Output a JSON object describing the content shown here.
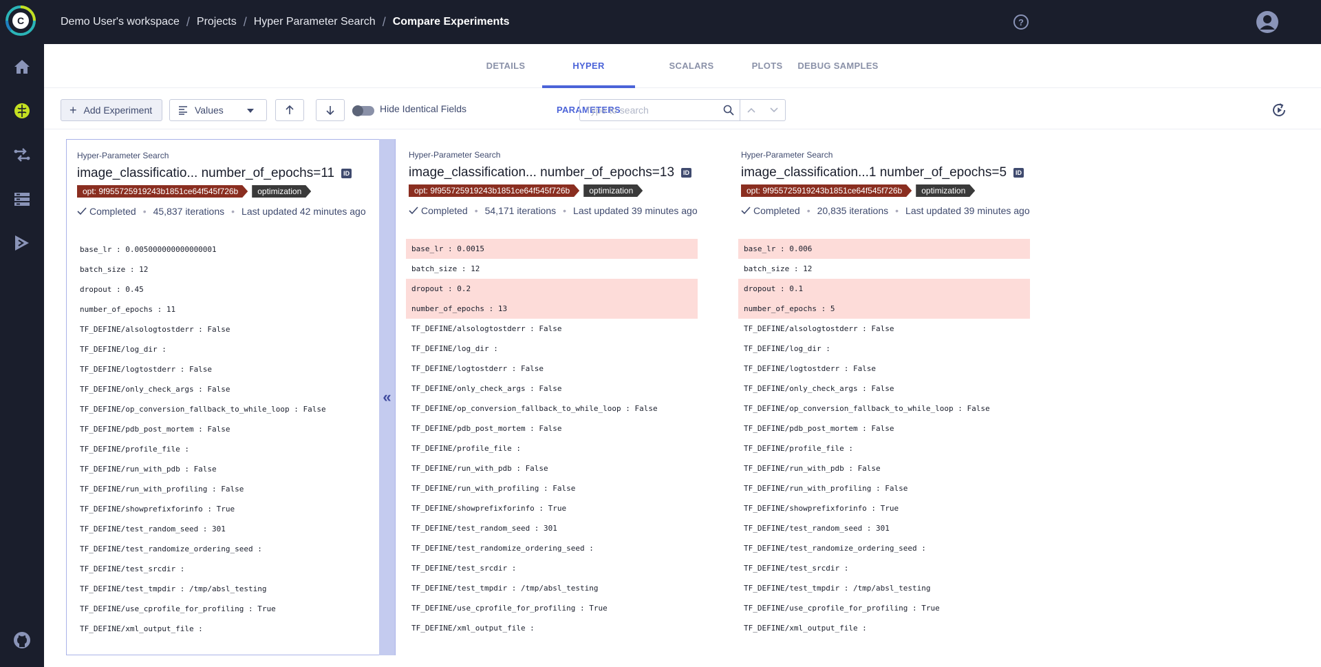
{
  "breadcrumb": {
    "workspace": "Demo User's workspace",
    "projects": "Projects",
    "project": "Hyper Parameter Search",
    "current": "Compare Experiments"
  },
  "tabs": [
    "DETAILS",
    "HYPER PARAMETERS",
    "SCALARS",
    "PLOTS",
    "DEBUG SAMPLES"
  ],
  "active_tab": "HYPER PARAMETERS",
  "toolbar": {
    "add_experiment": "Add Experiment",
    "values_select": "Values",
    "hide_identical": "Hide Identical Fields",
    "search_placeholder": "Type to search"
  },
  "colors": {
    "accent": "#4b63d8",
    "diff_row": "#fddcd9",
    "sidebar": "#1a1e2c",
    "brain_icon": "#c4e021"
  },
  "experiments": [
    {
      "type": "Hyper-Parameter Search",
      "name": "image_classificatio... number_of_epochs=11",
      "id_badge": "ID",
      "tag_opt": "opt: 9f955725919243b1851ce64f545f726b",
      "tag_optim": "optimization",
      "status": "Completed",
      "iterations": "45,837 iterations",
      "updated": "Last updated 42 minutes ago",
      "params": [
        {
          "text": "base_lr : 0.005000000000000001",
          "diff": false
        },
        {
          "text": "batch_size : 12",
          "diff": false
        },
        {
          "text": "dropout : 0.45",
          "diff": false
        },
        {
          "text": "number_of_epochs : 11",
          "diff": false
        },
        {
          "text": "TF_DEFINE/alsologtostderr : False",
          "diff": false
        },
        {
          "text": "TF_DEFINE/log_dir :",
          "diff": false
        },
        {
          "text": "TF_DEFINE/logtostderr : False",
          "diff": false
        },
        {
          "text": "TF_DEFINE/only_check_args : False",
          "diff": false
        },
        {
          "text": "TF_DEFINE/op_conversion_fallback_to_while_loop : False",
          "diff": false
        },
        {
          "text": "TF_DEFINE/pdb_post_mortem : False",
          "diff": false
        },
        {
          "text": "TF_DEFINE/profile_file :",
          "diff": false
        },
        {
          "text": "TF_DEFINE/run_with_pdb : False",
          "diff": false
        },
        {
          "text": "TF_DEFINE/run_with_profiling : False",
          "diff": false
        },
        {
          "text": "TF_DEFINE/showprefixforinfo : True",
          "diff": false
        },
        {
          "text": "TF_DEFINE/test_random_seed : 301",
          "diff": false
        },
        {
          "text": "TF_DEFINE/test_randomize_ordering_seed :",
          "diff": false
        },
        {
          "text": "TF_DEFINE/test_srcdir :",
          "diff": false
        },
        {
          "text": "TF_DEFINE/test_tmpdir : /tmp/absl_testing",
          "diff": false
        },
        {
          "text": "TF_DEFINE/use_cprofile_for_profiling : True",
          "diff": false
        },
        {
          "text": "TF_DEFINE/xml_output_file :",
          "diff": false
        }
      ]
    },
    {
      "type": "Hyper-Parameter Search",
      "name": "image_classification... number_of_epochs=13",
      "id_badge": "ID",
      "tag_opt": "opt: 9f955725919243b1851ce64f545f726b",
      "tag_optim": "optimization",
      "status": "Completed",
      "iterations": "54,171 iterations",
      "updated": "Last updated 39 minutes ago",
      "params": [
        {
          "text": "base_lr : 0.0015",
          "diff": true
        },
        {
          "text": "batch_size : 12",
          "diff": false
        },
        {
          "text": "dropout : 0.2",
          "diff": true
        },
        {
          "text": "number_of_epochs : 13",
          "diff": true
        },
        {
          "text": "TF_DEFINE/alsologtostderr : False",
          "diff": false
        },
        {
          "text": "TF_DEFINE/log_dir :",
          "diff": false
        },
        {
          "text": "TF_DEFINE/logtostderr : False",
          "diff": false
        },
        {
          "text": "TF_DEFINE/only_check_args : False",
          "diff": false
        },
        {
          "text": "TF_DEFINE/op_conversion_fallback_to_while_loop : False",
          "diff": false
        },
        {
          "text": "TF_DEFINE/pdb_post_mortem : False",
          "diff": false
        },
        {
          "text": "TF_DEFINE/profile_file :",
          "diff": false
        },
        {
          "text": "TF_DEFINE/run_with_pdb : False",
          "diff": false
        },
        {
          "text": "TF_DEFINE/run_with_profiling : False",
          "diff": false
        },
        {
          "text": "TF_DEFINE/showprefixforinfo : True",
          "diff": false
        },
        {
          "text": "TF_DEFINE/test_random_seed : 301",
          "diff": false
        },
        {
          "text": "TF_DEFINE/test_randomize_ordering_seed :",
          "diff": false
        },
        {
          "text": "TF_DEFINE/test_srcdir :",
          "diff": false
        },
        {
          "text": "TF_DEFINE/test_tmpdir : /tmp/absl_testing",
          "diff": false
        },
        {
          "text": "TF_DEFINE/use_cprofile_for_profiling : True",
          "diff": false
        },
        {
          "text": "TF_DEFINE/xml_output_file :",
          "diff": false
        }
      ]
    },
    {
      "type": "Hyper-Parameter Search",
      "name": "image_classification...1 number_of_epochs=5",
      "id_badge": "ID",
      "tag_opt": "opt: 9f955725919243b1851ce64f545f726b",
      "tag_optim": "optimization",
      "status": "Completed",
      "iterations": "20,835 iterations",
      "updated": "Last updated 39 minutes ago",
      "params": [
        {
          "text": "base_lr : 0.006",
          "diff": true
        },
        {
          "text": "batch_size : 12",
          "diff": false
        },
        {
          "text": "dropout : 0.1",
          "diff": true
        },
        {
          "text": "number_of_epochs : 5",
          "diff": true
        },
        {
          "text": "TF_DEFINE/alsologtostderr : False",
          "diff": false
        },
        {
          "text": "TF_DEFINE/log_dir :",
          "diff": false
        },
        {
          "text": "TF_DEFINE/logtostderr : False",
          "diff": false
        },
        {
          "text": "TF_DEFINE/only_check_args : False",
          "diff": false
        },
        {
          "text": "TF_DEFINE/op_conversion_fallback_to_while_loop : False",
          "diff": false
        },
        {
          "text": "TF_DEFINE/pdb_post_mortem : False",
          "diff": false
        },
        {
          "text": "TF_DEFINE/profile_file :",
          "diff": false
        },
        {
          "text": "TF_DEFINE/run_with_pdb : False",
          "diff": false
        },
        {
          "text": "TF_DEFINE/run_with_profiling : False",
          "diff": false
        },
        {
          "text": "TF_DEFINE/showprefixforinfo : True",
          "diff": false
        },
        {
          "text": "TF_DEFINE/test_random_seed : 301",
          "diff": false
        },
        {
          "text": "TF_DEFINE/test_randomize_ordering_seed :",
          "diff": false
        },
        {
          "text": "TF_DEFINE/test_srcdir :",
          "diff": false
        },
        {
          "text": "TF_DEFINE/test_tmpdir : /tmp/absl_testing",
          "diff": false
        },
        {
          "text": "TF_DEFINE/use_cprofile_for_profiling : True",
          "diff": false
        },
        {
          "text": "TF_DEFINE/xml_output_file :",
          "diff": false
        }
      ]
    }
  ]
}
